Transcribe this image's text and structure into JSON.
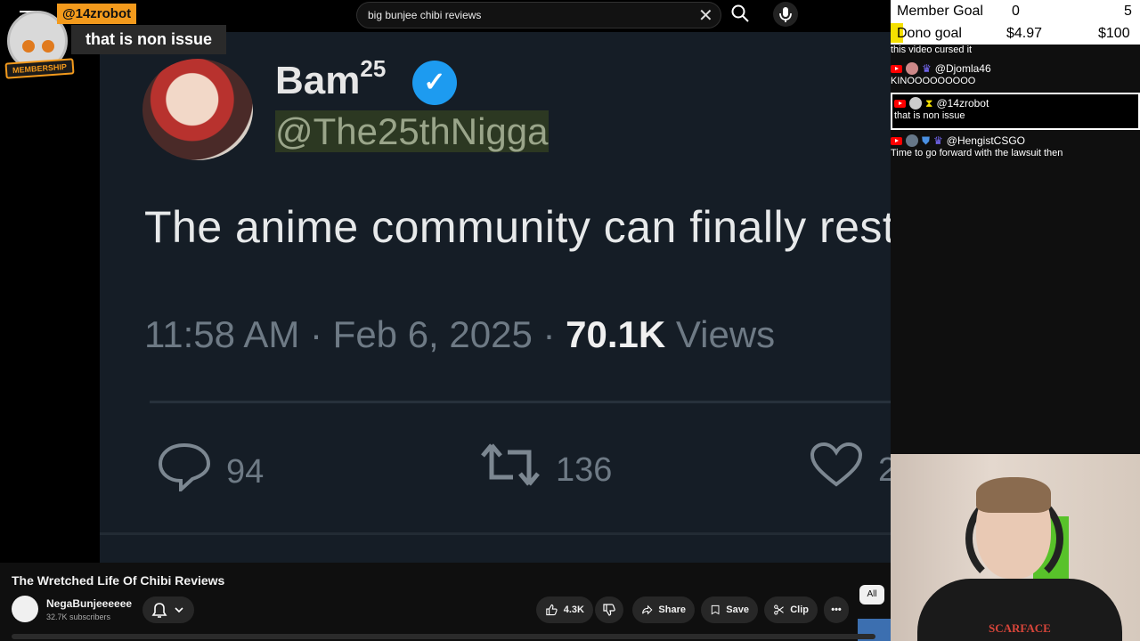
{
  "search": {
    "query": "big bunjee chibi reviews"
  },
  "popup": {
    "username": "@14zrobot",
    "message": "that is non issue",
    "badge": "MEMBERSHIP"
  },
  "tweet": {
    "name": "Bam",
    "name_sup": "25",
    "handle": "@The25thNigga",
    "text": "The anime community can finally rest",
    "time": "11:58 AM · Feb 6, 2025 · ",
    "views_count": "70.1K",
    "views_label": " Views",
    "replies": "94",
    "retweets": "136",
    "likes": "2"
  },
  "goals": {
    "member_label": "Member Goal",
    "member_current": "0",
    "member_target": "5",
    "dono_label": "Dono goal",
    "dono_current": "$4.97",
    "dono_target": "$100"
  },
  "chat": [
    {
      "user": "",
      "text": "this video cursed it"
    },
    {
      "user": "@Djomla46",
      "text": "KINOOOOOOOOO"
    },
    {
      "user": "@14zrobot",
      "text": "that is non issue"
    },
    {
      "user": "@HengistCSGO",
      "text": "Time to go forward with the lawsuit then"
    }
  ],
  "video": {
    "title": "The Wretched Life Of Chibi Reviews",
    "channel": "NegaBunjeeeeee",
    "subscribers": "32.7K subscribers",
    "likes": "4.3K",
    "share": "Share",
    "save": "Save",
    "clip": "Clip",
    "chip_all": "All"
  },
  "webcam": {
    "shirt_text": "SCARFACE"
  },
  "colors": {
    "accent": "#f39a1c",
    "verified": "#1d9bf0",
    "dono_bar": "#f5e000",
    "webcam_chair": "#58c22a"
  }
}
